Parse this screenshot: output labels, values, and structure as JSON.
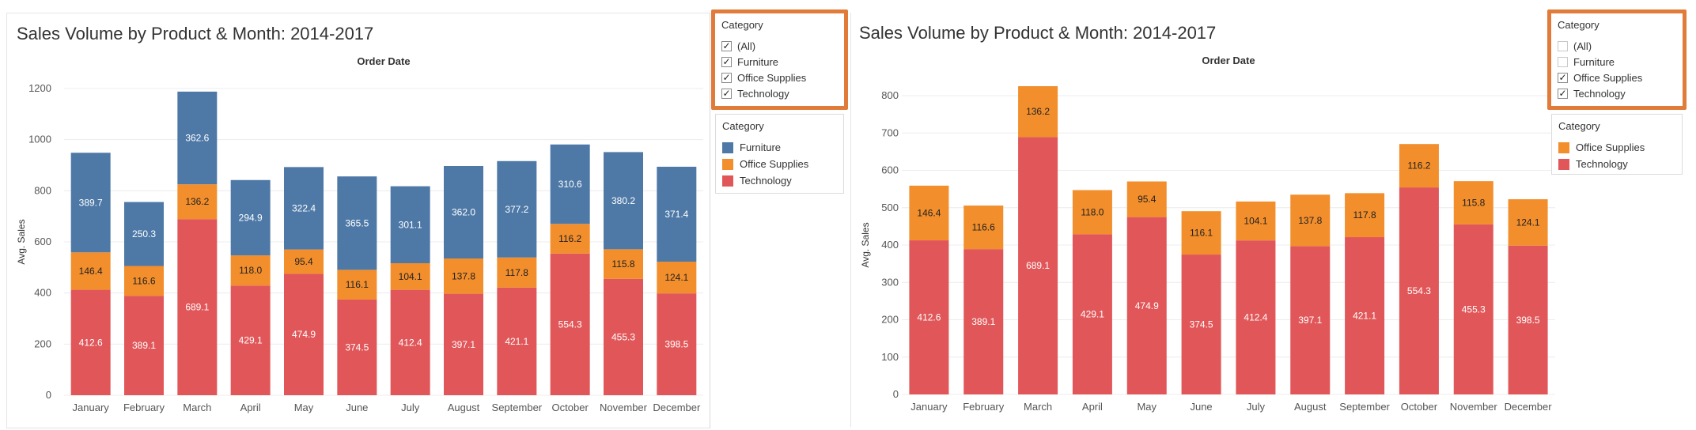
{
  "colors": {
    "furniture": "#4e79a7",
    "office_supplies": "#f28e2b",
    "technology": "#e15759",
    "highlight": "#e07b39"
  },
  "chart_data": [
    {
      "type": "bar",
      "stacked": true,
      "title": "Sales Volume by Product & Month: 2014-2017",
      "column_header": "Order Date",
      "ylabel": "Avg. Sales",
      "ylim": [
        0,
        1200
      ],
      "yticks": [
        0,
        200,
        400,
        600,
        800,
        1000,
        1200
      ],
      "categories": [
        "January",
        "February",
        "March",
        "April",
        "May",
        "June",
        "July",
        "August",
        "September",
        "October",
        "November",
        "December"
      ],
      "series": [
        {
          "name": "Technology",
          "color": "#e15759",
          "values": [
            412.6,
            389.1,
            689.1,
            429.1,
            474.9,
            374.5,
            412.4,
            397.1,
            421.1,
            554.3,
            455.3,
            398.5
          ]
        },
        {
          "name": "Office Supplies",
          "color": "#f28e2b",
          "values": [
            146.4,
            116.6,
            136.2,
            118.0,
            95.4,
            116.1,
            104.1,
            137.8,
            117.8,
            116.2,
            115.8,
            124.1
          ]
        },
        {
          "name": "Furniture",
          "color": "#4e79a7",
          "values": [
            389.7,
            250.3,
            362.6,
            294.9,
            322.4,
            365.5,
            301.1,
            362.0,
            377.2,
            310.6,
            380.2,
            371.4
          ]
        }
      ],
      "filter": {
        "title": "Category",
        "items": [
          {
            "label": "(All)",
            "checked": true
          },
          {
            "label": "Furniture",
            "checked": true
          },
          {
            "label": "Office Supplies",
            "checked": true
          },
          {
            "label": "Technology",
            "checked": true
          }
        ]
      },
      "legend": {
        "title": "Category",
        "items": [
          {
            "label": "Furniture",
            "color": "#4e79a7"
          },
          {
            "label": "Office Supplies",
            "color": "#f28e2b"
          },
          {
            "label": "Technology",
            "color": "#e15759"
          }
        ]
      }
    },
    {
      "type": "bar",
      "stacked": true,
      "title": "Sales Volume by Product & Month: 2014-2017",
      "column_header": "Order Date",
      "ylabel": "Avg. Sales",
      "ylim": [
        0,
        800
      ],
      "yticks": [
        0,
        100,
        200,
        300,
        400,
        500,
        600,
        700,
        800
      ],
      "categories": [
        "January",
        "February",
        "March",
        "April",
        "May",
        "June",
        "July",
        "August",
        "September",
        "October",
        "November",
        "December"
      ],
      "series": [
        {
          "name": "Technology",
          "color": "#e15759",
          "values": [
            412.6,
            389.1,
            689.1,
            429.1,
            474.9,
            374.5,
            412.4,
            397.1,
            421.1,
            554.3,
            455.3,
            398.5
          ]
        },
        {
          "name": "Office Supplies",
          "color": "#f28e2b",
          "values": [
            146.4,
            116.6,
            136.2,
            118.0,
            95.4,
            116.1,
            104.1,
            137.8,
            117.8,
            116.2,
            115.8,
            124.1
          ]
        }
      ],
      "filter": {
        "title": "Category",
        "items": [
          {
            "label": "(All)",
            "checked": false
          },
          {
            "label": "Furniture",
            "checked": false
          },
          {
            "label": "Office Supplies",
            "checked": true
          },
          {
            "label": "Technology",
            "checked": true
          }
        ]
      },
      "legend": {
        "title": "Category",
        "items": [
          {
            "label": "Office Supplies",
            "color": "#f28e2b"
          },
          {
            "label": "Technology",
            "color": "#e15759"
          }
        ]
      }
    }
  ]
}
